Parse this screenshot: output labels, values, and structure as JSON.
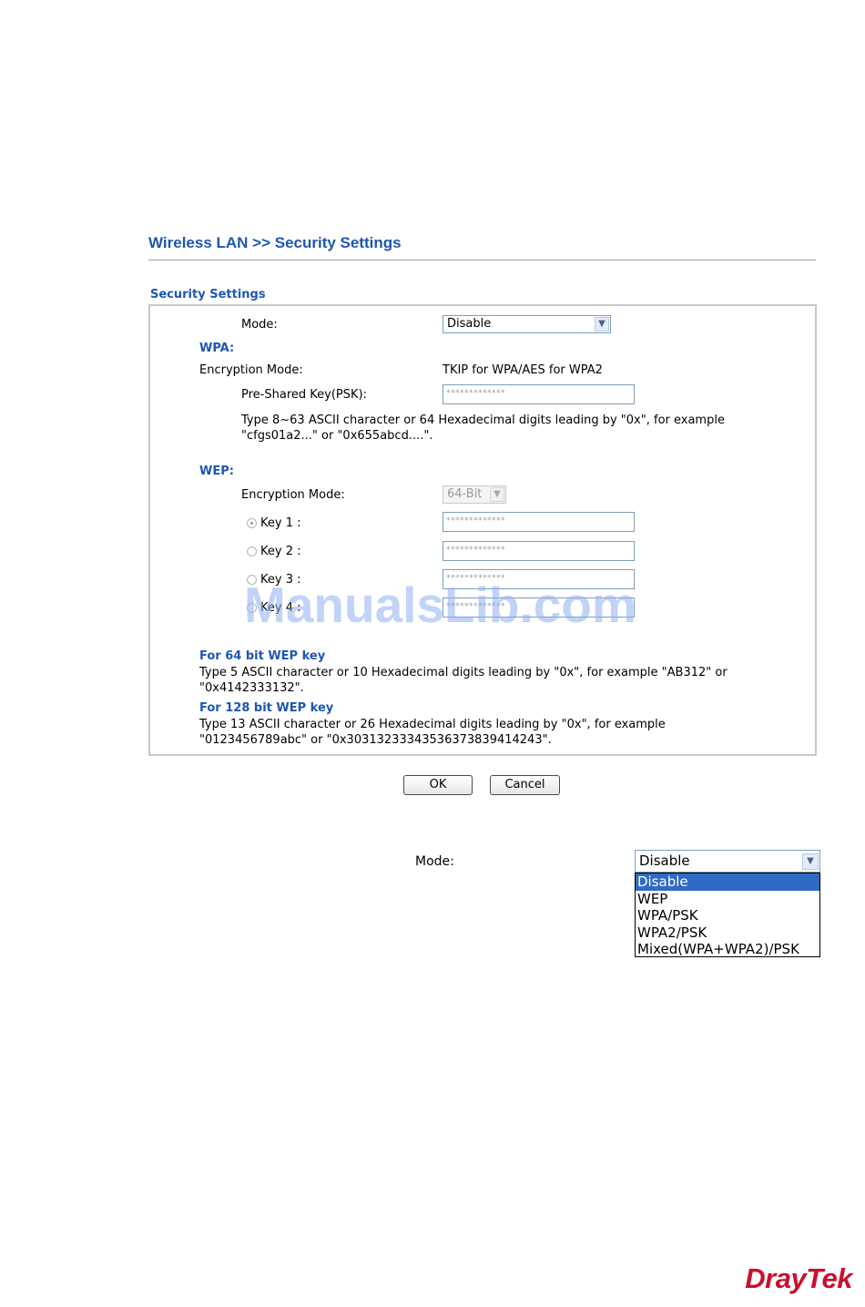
{
  "page": {
    "title": "Wireless LAN >> Security Settings"
  },
  "section": {
    "title": "Security Settings"
  },
  "mode": {
    "label": "Mode:",
    "value": "Disable"
  },
  "wpa": {
    "heading": "WPA:",
    "encryption_label": "Encryption Mode:",
    "encryption_value": "TKIP for WPA/AES for WPA2",
    "psk_label": "Pre-Shared Key(PSK):",
    "psk_value": "*************",
    "hint_line1": "Type 8~63 ASCII character or 64 Hexadecimal digits leading by \"0x\", for example",
    "hint_line2": "\"cfgs01a2...\" or \"0x655abcd....\"."
  },
  "wep": {
    "heading": "WEP:",
    "encryption_label": "Encryption Mode:",
    "encryption_value": "64-Bit",
    "keys": [
      {
        "label": "Key 1 :",
        "value": "*************",
        "checked": true
      },
      {
        "label": "Key 2 :",
        "value": "*************",
        "checked": false
      },
      {
        "label": "Key 3 :",
        "value": "*************",
        "checked": false
      },
      {
        "label": "Key 4 :",
        "value": "*************",
        "checked": false
      }
    ]
  },
  "notes": {
    "bit64_heading": "For 64 bit WEP key",
    "bit64_line1": "Type 5 ASCII character or 10 Hexadecimal digits leading by \"0x\", for example \"AB312\" or",
    "bit64_line2": "\"0x4142333132\".",
    "bit128_heading": "For 128 bit WEP key",
    "bit128_line1": "Type 13 ASCII character or 26 Hexadecimal digits leading by \"0x\", for example",
    "bit128_line2": "\"0123456789abc\" or \"0x30313233343536373839414243\"."
  },
  "buttons": {
    "ok": "OK",
    "cancel": "Cancel"
  },
  "mode_dropdown": {
    "label": "Mode:",
    "value": "Disable",
    "options": [
      "Disable",
      "WEP",
      "WPA/PSK",
      "WPA2/PSK",
      "Mixed(WPA+WPA2)/PSK"
    ],
    "selected_index": 0
  },
  "watermark": "ManualsLib.com",
  "logo": "DrayTek",
  "colors": {
    "heading_blue": "#1e56b0",
    "selection_blue": "#316ac5",
    "logo_red": "#c8102e"
  }
}
